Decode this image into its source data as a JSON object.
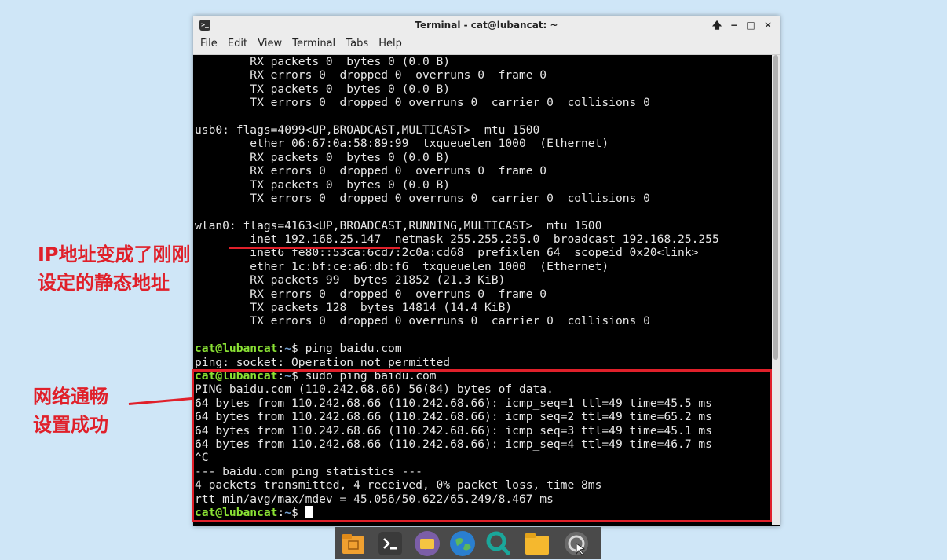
{
  "window": {
    "title": "Terminal - cat@lubancat: ~",
    "menu": [
      "File",
      "Edit",
      "View",
      "Terminal",
      "Tabs",
      "Help"
    ],
    "controls": {
      "pin": "🡅",
      "minimize": "−",
      "maximize": "□",
      "close": "✕"
    }
  },
  "terminal": {
    "lines": [
      "        RX packets 0  bytes 0 (0.0 B)",
      "        RX errors 0  dropped 0  overruns 0  frame 0",
      "        TX packets 0  bytes 0 (0.0 B)",
      "        TX errors 0  dropped 0 overruns 0  carrier 0  collisions 0",
      "",
      "usb0: flags=4099<UP,BROADCAST,MULTICAST>  mtu 1500",
      "        ether 06:67:0a:58:89:99  txqueuelen 1000  (Ethernet)",
      "        RX packets 0  bytes 0 (0.0 B)",
      "        RX errors 0  dropped 0  overruns 0  frame 0",
      "        TX packets 0  bytes 0 (0.0 B)",
      "        TX errors 0  dropped 0 overruns 0  carrier 0  collisions 0",
      "",
      "wlan0: flags=4163<UP,BROADCAST,RUNNING,MULTICAST>  mtu 1500",
      "        inet 192.168.25.147  netmask 255.255.255.0  broadcast 192.168.25.255",
      "        inet6 fe80::53ca:6cd7:2c0a:cd68  prefixlen 64  scopeid 0x20<link>",
      "        ether 1c:bf:ce:a6:db:f6  txqueuelen 1000  (Ethernet)",
      "        RX packets 99  bytes 21852 (21.3 KiB)",
      "        RX errors 0  dropped 0  overruns 0  frame 0",
      "        TX packets 128  bytes 14814 (14.4 KiB)",
      "        TX errors 0  dropped 0 overruns 0  carrier 0  collisions 0",
      "",
      {
        "prompt": true,
        "text": " ping baidu.com"
      },
      "ping: socket: Operation not permitted",
      {
        "prompt": true,
        "text": " sudo ping baidu.com"
      },
      "PING baidu.com (110.242.68.66) 56(84) bytes of data.",
      "64 bytes from 110.242.68.66 (110.242.68.66): icmp_seq=1 ttl=49 time=45.5 ms",
      "64 bytes from 110.242.68.66 (110.242.68.66): icmp_seq=2 ttl=49 time=65.2 ms",
      "64 bytes from 110.242.68.66 (110.242.68.66): icmp_seq=3 ttl=49 time=45.1 ms",
      "64 bytes from 110.242.68.66 (110.242.68.66): icmp_seq=4 ttl=49 time=46.7 ms",
      "^C",
      "--- baidu.com ping statistics ---",
      "4 packets transmitted, 4 received, 0% packet loss, time 8ms",
      "rtt min/avg/max/mdev = 45.056/50.622/65.249/8.467 ms",
      {
        "prompt": true,
        "text": " ",
        "cursor": true
      }
    ],
    "prompt_user": "cat@lubancat",
    "prompt_sep": ":",
    "prompt_path": "~",
    "prompt_dollar": "$"
  },
  "annotations": {
    "ip_note_line1": "IP地址变成了刚刚",
    "ip_note_line2": "设定的静态地址",
    "net_note_line1": "网络通畅",
    "net_note_line2": "设置成功",
    "color": "#e0202a"
  },
  "dock": {
    "items": [
      {
        "name": "file-manager-home-icon",
        "color": "#f0a030"
      },
      {
        "name": "terminal-icon",
        "color": "#3a3a3a"
      },
      {
        "name": "folder-icon",
        "color": "#7b5ea7"
      },
      {
        "name": "web-browser-globe-icon",
        "color": "#2a7fd0"
      },
      {
        "name": "search-icon",
        "color": "#1aa69a"
      },
      {
        "name": "folder-yellow-icon",
        "color": "#f5b82e"
      },
      {
        "name": "screenshot-icon",
        "color": "#6a6a6a"
      }
    ]
  }
}
